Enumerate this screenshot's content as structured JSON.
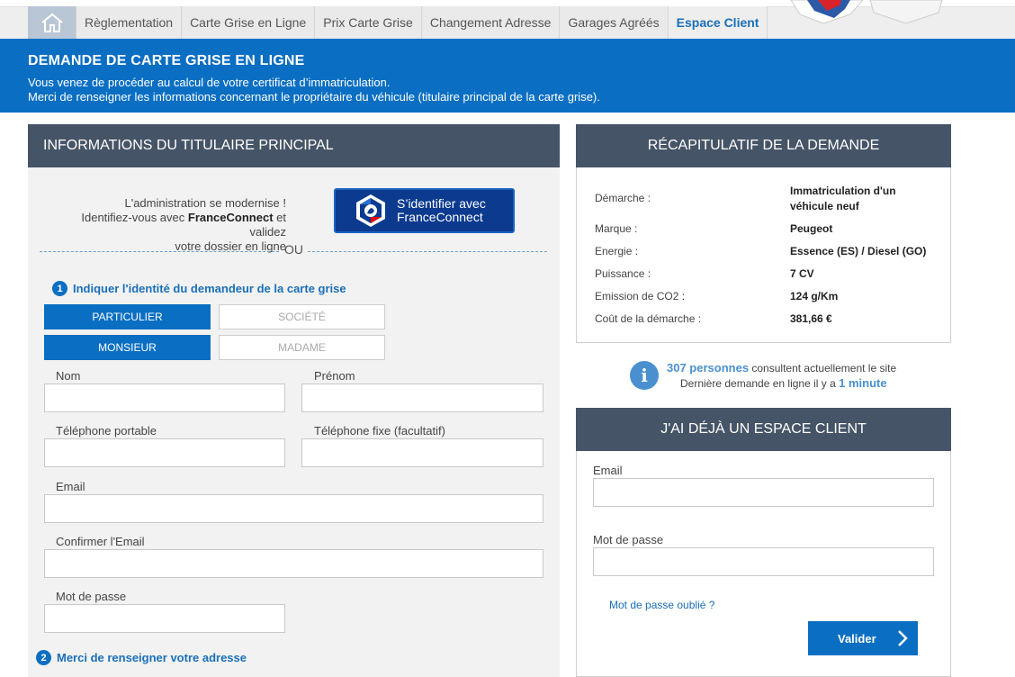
{
  "nav": {
    "items": [
      "Règlementation",
      "Carte Grise en Ligne",
      "Prix Carte Grise",
      "Changement Adresse",
      "Garages Agréés",
      "Espace Client"
    ],
    "active_index": 5
  },
  "banner": {
    "title": "DEMANDE DE CARTE GRISE EN LIGNE",
    "line1": "Vous venez de procéder au calcul de votre certificat d’immatriculation.",
    "line2": "Merci de renseigner les informations concernant le propriétaire du véhicule (titulaire principal de la carte grise)."
  },
  "titulaire": {
    "header": "INFORMATIONS DU TITULAIRE PRINCIPAL",
    "fc_line1": "L'administration se modernise !",
    "fc_line2_pre": "Identifiez-vous avec ",
    "fc_line2_bold": "FranceConnect",
    "fc_line2_post": " et validez",
    "fc_line3": "votre dossier en ligne",
    "fc_button_line1": "S’identifier avec",
    "fc_button_line2": "FranceConnect",
    "ou": "OU",
    "step1_num": "1",
    "step1_label": "Indiquer l'identité du demandeur de la carte grise",
    "particulier": "PARTICULIER",
    "societe": "SOCIÉTÉ",
    "monsieur": "MONSIEUR",
    "madame": "MADAME",
    "nom_label": "Nom",
    "prenom_label": "Prénom",
    "tel_portable_label": "Téléphone portable",
    "tel_fixe_label": "Téléphone fixe (facultatif)",
    "email_label": "Email",
    "confirm_email_label": "Confirmer l'Email",
    "password_label": "Mot de passe",
    "step2_num": "2",
    "step2_label": "Merci de renseigner votre adresse"
  },
  "recap": {
    "header": "RÉCAPITULATIF DE LA DEMANDE",
    "rows": [
      {
        "label": "Démarche :",
        "value": "Immatriculation d'un véhicule neuf"
      },
      {
        "label": "Marque :",
        "value": "Peugeot"
      },
      {
        "label": "Energie :",
        "value": "Essence (ES) / Diesel (GO)"
      },
      {
        "label": "Puissance :",
        "value": "7 CV"
      },
      {
        "label": "Emission de CO2 :",
        "value": "124 g/Km"
      },
      {
        "label": "Coût de la démarche :",
        "value": "381,66 €"
      }
    ]
  },
  "info": {
    "count": "307 personnes",
    "line1_rest": " consultent actuellement le site",
    "line2_pre": "Dernière demande en ligne il y a ",
    "line2_time": "1 minute"
  },
  "client": {
    "header": "J'AI DÉJÀ UN ESPACE CLIENT",
    "email_label": "Email",
    "password_label": "Mot de passe",
    "forgot": "Mot de passe oublié ?",
    "submit": "Valider"
  },
  "colors": {
    "brand_blue": "#0a6fc2",
    "header_slate": "#465467",
    "link_blue": "#1a6fb8"
  }
}
